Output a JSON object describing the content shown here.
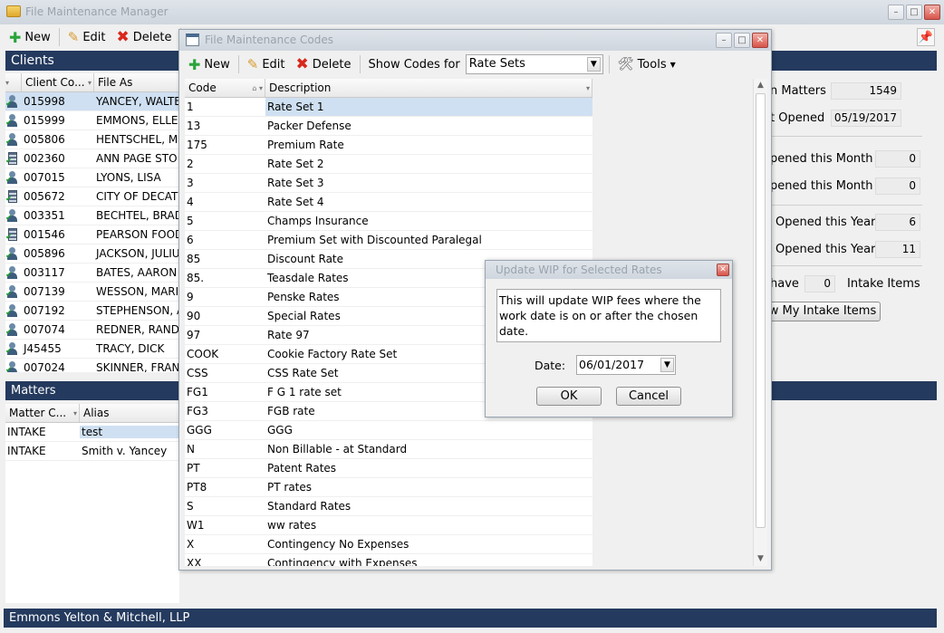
{
  "main_window": {
    "title": "File Maintenance Manager",
    "toolbar": {
      "new_label": "New",
      "edit_label": "Edit",
      "delete_label": "Delete"
    }
  },
  "clients": {
    "header": "Clients",
    "columns": [
      "Client Co...",
      "File As"
    ],
    "rows": [
      {
        "code": "015998",
        "name": "YANCEY, WALTE",
        "icon": "person-icon"
      },
      {
        "code": "015999",
        "name": "EMMONS, ELLE",
        "icon": "person-icon"
      },
      {
        "code": "005806",
        "name": "HENTSCHEL, MI",
        "icon": "person-icon"
      },
      {
        "code": "002360",
        "name": "ANN PAGE STO",
        "icon": "building-icon"
      },
      {
        "code": "007015",
        "name": "LYONS, LISA",
        "icon": "person-icon"
      },
      {
        "code": "005672",
        "name": "CITY OF DECATU",
        "icon": "building-icon"
      },
      {
        "code": "003351",
        "name": "BECHTEL, BRAD",
        "icon": "person-icon"
      },
      {
        "code": "001546",
        "name": "PEARSON FOOD",
        "icon": "building-icon"
      },
      {
        "code": "005896",
        "name": "JACKSON, JULIU",
        "icon": "person-icon"
      },
      {
        "code": "003117",
        "name": "BATES, AARON",
        "icon": "person-icon"
      },
      {
        "code": "007139",
        "name": "WESSON, MARI",
        "icon": "person-icon"
      },
      {
        "code": "007192",
        "name": "STEPHENSON, A",
        "icon": "person-icon"
      },
      {
        "code": "007074",
        "name": "REDNER, RAND",
        "icon": "person-icon"
      },
      {
        "code": "J45455",
        "name": "TRACY, DICK",
        "icon": "person-icon"
      },
      {
        "code": "007024",
        "name": "SKINNER, FRAN",
        "icon": "person-icon"
      }
    ]
  },
  "matters": {
    "header": "Matters",
    "columns": [
      "Matter C...",
      "Alias"
    ],
    "rows": [
      {
        "code": "INTAKE",
        "alias": "test"
      },
      {
        "code": "INTAKE",
        "alias": "Smith v. Yancey"
      }
    ]
  },
  "stats": {
    "open_matters_label": "n Matters",
    "open_matters_value": "1549",
    "last_opened_label": "t Opened",
    "last_opened_value": "05/19/2017",
    "opened_month_1_label": "pened this Month",
    "opened_month_1_value": "0",
    "opened_month_2_label": "pened this Month",
    "opened_month_2_value": "0",
    "opened_year_1_label": "Opened this Year",
    "opened_year_1_value": "6",
    "opened_year_2_label": "Opened this Year",
    "opened_year_2_value": "11",
    "intake_prefix": "have",
    "intake_count": "0",
    "intake_suffix": "Intake Items",
    "view_intake_button": "w My Intake Items"
  },
  "status_bar": {
    "text": "Emmons Yelton & Mitchell, LLP"
  },
  "codes_window": {
    "title": "File Maintenance Codes",
    "toolbar": {
      "new_label": "New",
      "edit_label": "Edit",
      "delete_label": "Delete",
      "show_codes_label": "Show Codes for",
      "show_codes_value": "Rate Sets",
      "tools_label": "Tools"
    },
    "columns": [
      "Code",
      "Description"
    ],
    "rows": [
      {
        "code": "1",
        "desc": "Rate Set 1"
      },
      {
        "code": "13",
        "desc": "Packer Defense"
      },
      {
        "code": "175",
        "desc": "Premium Rate"
      },
      {
        "code": "2",
        "desc": "Rate Set 2"
      },
      {
        "code": "3",
        "desc": "Rate Set 3"
      },
      {
        "code": "4",
        "desc": "Rate Set 4"
      },
      {
        "code": "5",
        "desc": "Champs Insurance"
      },
      {
        "code": "6",
        "desc": "Premium Set with Discounted Paralegal"
      },
      {
        "code": "85",
        "desc": "Discount Rate"
      },
      {
        "code": "85.",
        "desc": "Teasdale Rates"
      },
      {
        "code": "9",
        "desc": "Penske Rates"
      },
      {
        "code": "90",
        "desc": "Special Rates"
      },
      {
        "code": "97",
        "desc": "Rate 97"
      },
      {
        "code": "COOK",
        "desc": "Cookie Factory Rate Set"
      },
      {
        "code": "CSS",
        "desc": "CSS Rate Set"
      },
      {
        "code": "FG1",
        "desc": "F G 1 rate set"
      },
      {
        "code": "FG3",
        "desc": "FGB rate"
      },
      {
        "code": "GGG",
        "desc": "GGG"
      },
      {
        "code": "N",
        "desc": "Non Billable - at Standard"
      },
      {
        "code": "PT",
        "desc": "Patent Rates"
      },
      {
        "code": "PT8",
        "desc": "PT rates"
      },
      {
        "code": "S",
        "desc": "Standard Rates"
      },
      {
        "code": "W1",
        "desc": "ww rates"
      },
      {
        "code": "X",
        "desc": "Contingency No Expenses"
      },
      {
        "code": "XX",
        "desc": "Contingency with Expenses"
      }
    ]
  },
  "wip_dialog": {
    "title": "Update WIP for Selected Rates",
    "message": "This will update WIP fees where the work date is on or after the chosen date.",
    "date_label": "Date:",
    "date_value": "06/01/2017",
    "ok_label": "OK",
    "cancel_label": "Cancel"
  },
  "colors": {
    "panel_header": "#243a5e",
    "selection": "#cfe0f2"
  }
}
